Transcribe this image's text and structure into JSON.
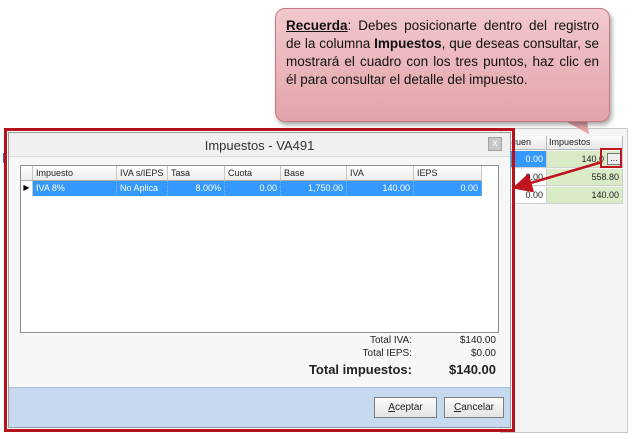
{
  "callout": {
    "recuerda": "Recuerda",
    "text_1": ": Debes posicionarte dentro del registro de la columna ",
    "bold_col": "Impuestos",
    "text_2": ", que deseas consultar, se mostrará el cuadro con los tres puntos, haz clic en él para consultar el detalle del impuesto."
  },
  "background_grid": {
    "headers": [
      "scuen",
      "Impuestos"
    ],
    "rows": [
      {
        "desc": "0.00",
        "impuestos": "140.0"
      },
      {
        "desc": "0.00",
        "impuestos": "558.80"
      },
      {
        "desc": "0.00",
        "impuestos": "140.00"
      }
    ],
    "dots_label": "..."
  },
  "dialog": {
    "title": "Impuestos - VA491",
    "close_label": "x",
    "columns": [
      "Impuesto",
      "IVA s/IEPS",
      "Tasa",
      "Cuota",
      "Base",
      "IVA",
      "IEPS"
    ],
    "rows": [
      {
        "impuesto": "IVA 8%",
        "iva_s_ieps": "No Aplica",
        "tasa": "8.00%",
        "cuota": "0.00",
        "base": "1,750.00",
        "iva": "140.00",
        "ieps": "0.00"
      }
    ],
    "row_indicator": "▶",
    "totals": {
      "total_iva_label": "Total IVA:",
      "total_iva_value": "$140.00",
      "total_ieps_label": "Total IEPS:",
      "total_ieps_value": "$0.00",
      "total_impuestos_label": "Total impuestos:",
      "total_impuestos_value": "$140.00"
    },
    "buttons": {
      "aceptar_first": "A",
      "aceptar_rest": "ceptar",
      "cancelar_first": "C",
      "cancelar_rest": "ancelar"
    }
  },
  "colors": {
    "highlight_red": "#b5121b",
    "selection_blue": "#3399ff",
    "callout_pink": "#e2a2a9",
    "footer_blue": "#c7d9ef"
  }
}
